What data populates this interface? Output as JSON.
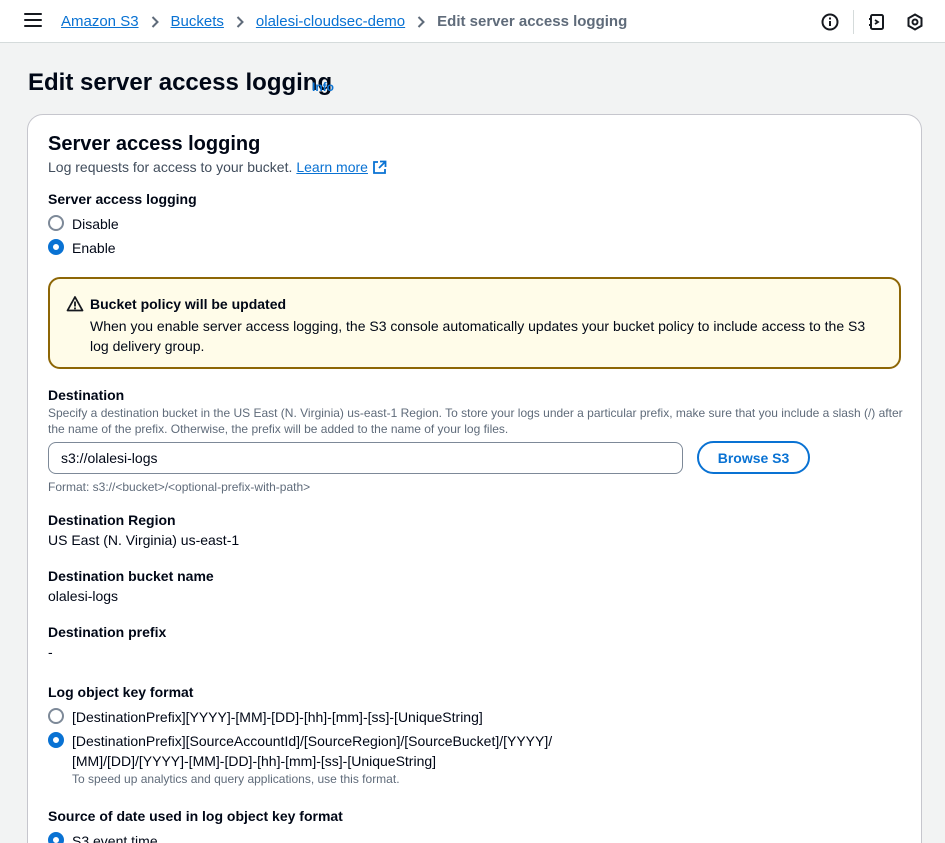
{
  "breadcrumb": {
    "items": [
      "Amazon S3",
      "Buckets",
      "olalesi-cloudsec-demo"
    ],
    "current": "Edit server access logging"
  },
  "icons": {
    "menu": "hamburger-menu-icon",
    "info": "info-circle-icon",
    "notifications": "notifications-icon",
    "settings": "settings-icon",
    "external": "external-link-icon",
    "warning": "warning-icon"
  },
  "page": {
    "title": "Edit server access logging",
    "info_link": "Info"
  },
  "section": {
    "title": "Server access logging",
    "description": "Log requests for access to your bucket.",
    "learn_more": "Learn more"
  },
  "logging": {
    "label": "Server access logging",
    "options": [
      "Disable",
      "Enable"
    ],
    "selected": "Enable"
  },
  "alert": {
    "title": "Bucket policy will be updated",
    "body": "When you enable server access logging, the S3 console automatically updates your bucket policy to include access to the S3 log delivery group."
  },
  "destination": {
    "label": "Destination",
    "description": "Specify a destination bucket in the US East (N. Virginia) us-east-1 Region. To store your logs under a particular prefix, make sure that you include a slash (/) after the name of the prefix. Otherwise, the prefix will be added to the name of your log files.",
    "value": "s3://olalesi-logs",
    "browse_button": "Browse S3",
    "format_hint": "Format: s3://<bucket>/<optional-prefix-with-path>"
  },
  "details": {
    "region_label": "Destination Region",
    "region_value": "US East (N. Virginia) us-east-1",
    "bucket_label": "Destination bucket name",
    "bucket_value": "olalesi-logs",
    "prefix_label": "Destination prefix",
    "prefix_value": "-"
  },
  "key_format": {
    "label": "Log object key format",
    "option1": "[DestinationPrefix][YYYY]-[MM]-[DD]-[hh]-[mm]-[ss]-[UniqueString]",
    "option2_line1": "[DestinationPrefix][SourceAccountId]/[SourceRegion]/[SourceBucket]/[YYYY]/",
    "option2_line2": "[MM]/[DD]/[YYYY]-[MM]-[DD]-[hh]-[mm]-[ss]-[UniqueString]",
    "option2_hint": "To speed up analytics and query applications, use this format.",
    "selected": 2
  },
  "date_source": {
    "label": "Source of date used in log object key format",
    "option1": "S3 event time"
  },
  "colors": {
    "link": "#0972d3",
    "alert_bg": "#fffce9",
    "alert_border": "#8d6605"
  }
}
